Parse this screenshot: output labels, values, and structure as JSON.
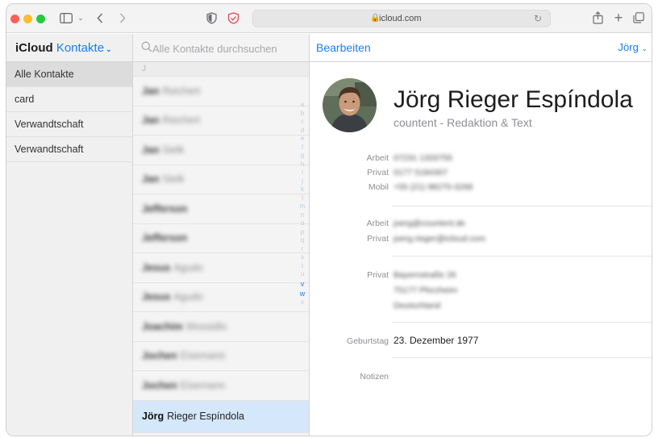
{
  "browser": {
    "url": "icloud.com"
  },
  "header": {
    "brand_left": "iCloud",
    "brand_right": "Kontakte",
    "search_placeholder": "Alle Kontakte durchsuchen",
    "edit_label": "Bearbeiten",
    "user_label": "Jörg"
  },
  "sidebar": {
    "groups": [
      "Alle Kontakte",
      "card",
      "Verwandtschaft",
      "Verwandtschaft"
    ]
  },
  "list": {
    "section_letter": "J",
    "contacts": [
      {
        "first": "Jan",
        "last": "Reichert"
      },
      {
        "first": "Jan",
        "last": "Reichert"
      },
      {
        "first": "Jan",
        "last": "Sielk"
      },
      {
        "first": "Jan",
        "last": "Sielk"
      },
      {
        "first": "Jefferson",
        "last": ""
      },
      {
        "first": "Jefferson",
        "last": ""
      },
      {
        "first": "Jesus",
        "last": "Agudo"
      },
      {
        "first": "Jesus",
        "last": "Agudo"
      },
      {
        "first": "Joachim",
        "last": "Wossidlo"
      },
      {
        "first": "Jochen",
        "last": "Eisemann"
      },
      {
        "first": "Jochen",
        "last": "Eisemann"
      },
      {
        "first": "Jörg",
        "last": "Rieger Espíndola"
      }
    ],
    "index": [
      "A",
      "B",
      "C",
      "D",
      "E",
      "F",
      "G",
      "H",
      "I",
      "J",
      "K",
      "L",
      "M",
      "N",
      "O",
      "P",
      "Q",
      "R",
      "S",
      "T",
      "U",
      "V",
      "W",
      "X"
    ]
  },
  "detail": {
    "name": "Jörg Rieger Espíndola",
    "company": "countent - Redaktion & Text",
    "phone_labels": [
      "Arbeit",
      "Privat",
      "Mobil"
    ],
    "phones": [
      "07231 1333755",
      "0177 5184307",
      "+55 (21) 98270-3268"
    ],
    "email_labels": [
      "Arbeit",
      "Privat"
    ],
    "emails": [
      "joerg@countent.de",
      "joerg.rieger@icloud.com"
    ],
    "address_label": "Privat",
    "address_lines": [
      "Bayernstraße 26",
      "75177 Pforzheim",
      "Deutschland"
    ],
    "birthday_label": "Geburtstag",
    "birthday": "23. Dezember 1977",
    "notes_label": "Notizen"
  },
  "colors": {
    "accent": "#1a7cf5",
    "selection": "#d4e7fb"
  },
  "icons": [
    "sidebar-toggle-icon",
    "back-icon",
    "forward-icon",
    "privacy-shield-icon",
    "security-report-icon",
    "lock-icon",
    "reload-icon",
    "share-icon",
    "new-tab-icon",
    "tabs-overview-icon",
    "search-icon"
  ]
}
